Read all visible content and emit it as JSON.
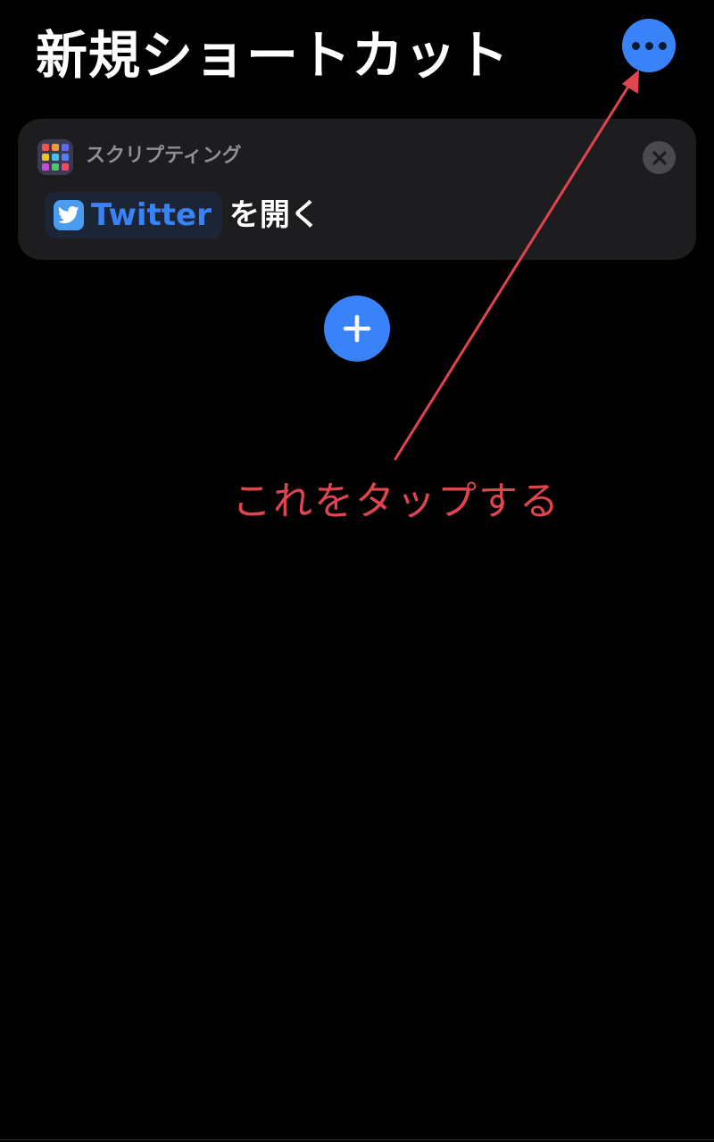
{
  "header": {
    "title": "新規ショートカット",
    "more_icon": "ellipsis-icon"
  },
  "action_card": {
    "category": "スクリプティング",
    "category_icon": "scripting-grid-icon",
    "app_name": "Twitter",
    "app_icon": "twitter-bird-icon",
    "action_suffix": "を開く",
    "close_icon": "close-icon"
  },
  "add_button": {
    "icon": "plus-icon"
  },
  "annotation": {
    "text": "これをタップする"
  },
  "colors": {
    "accent": "#3a82f7",
    "background": "#000000",
    "card": "#1d1d1f",
    "annotation": "#e0444f"
  }
}
